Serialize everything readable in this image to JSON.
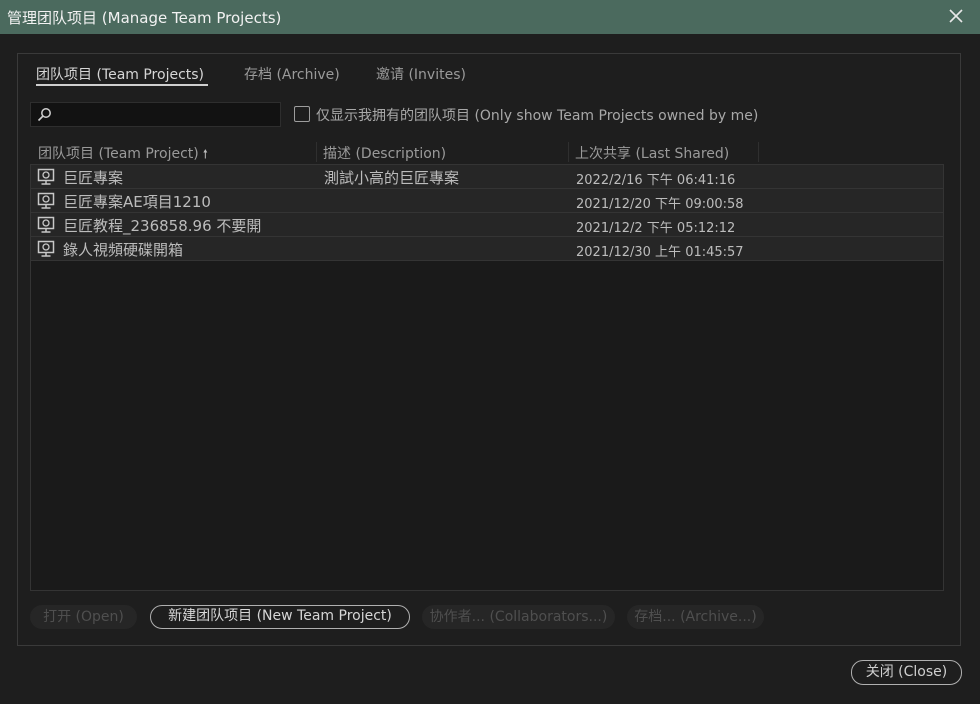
{
  "window": {
    "title": "管理团队项目 (Manage Team Projects)"
  },
  "tabs": [
    {
      "label": "团队项目 (Team Projects)",
      "active": true
    },
    {
      "label": "存档 (Archive)",
      "active": false
    },
    {
      "label": "邀请 (Invites)",
      "active": false
    }
  ],
  "search": {
    "value": "",
    "placeholder": ""
  },
  "filter": {
    "label": "仅显示我拥有的团队项目 (Only show Team Projects owned by me)",
    "checked": false
  },
  "table": {
    "columns": [
      "团队项目 (Team Project)",
      "描述 (Description)",
      "上次共享 (Last Shared)"
    ],
    "sort_arrow": "🠕",
    "rows": [
      {
        "name": "巨匠專案",
        "description": "測試小高的巨匠專案",
        "last_shared": "2022/2/16 下午 06:41:16"
      },
      {
        "name": "巨匠專案AE項目1210",
        "description": "",
        "last_shared": "2021/12/20 下午 09:00:58"
      },
      {
        "name": "巨匠教程_236858.96 不要開",
        "description": "",
        "last_shared": "2021/12/2 下午 05:12:12"
      },
      {
        "name": "錄人視頻硬碟開箱",
        "description": "",
        "last_shared": "2021/12/30 上午 01:45:57"
      }
    ]
  },
  "buttons": {
    "open": "打开 (Open)",
    "new_team_project": "新建团队项目 (New Team Project)",
    "collaborators": "协作者... (Collaborators...)",
    "archive": "存档... (Archive...)",
    "close": "关闭 (Close)"
  },
  "icons": {
    "window_close": "close-icon",
    "search": "search-icon",
    "team_project": "team-project-icon"
  },
  "colors": {
    "titlebar": "#4b6a5e",
    "background": "#1e1e1e",
    "row": "#262626"
  }
}
